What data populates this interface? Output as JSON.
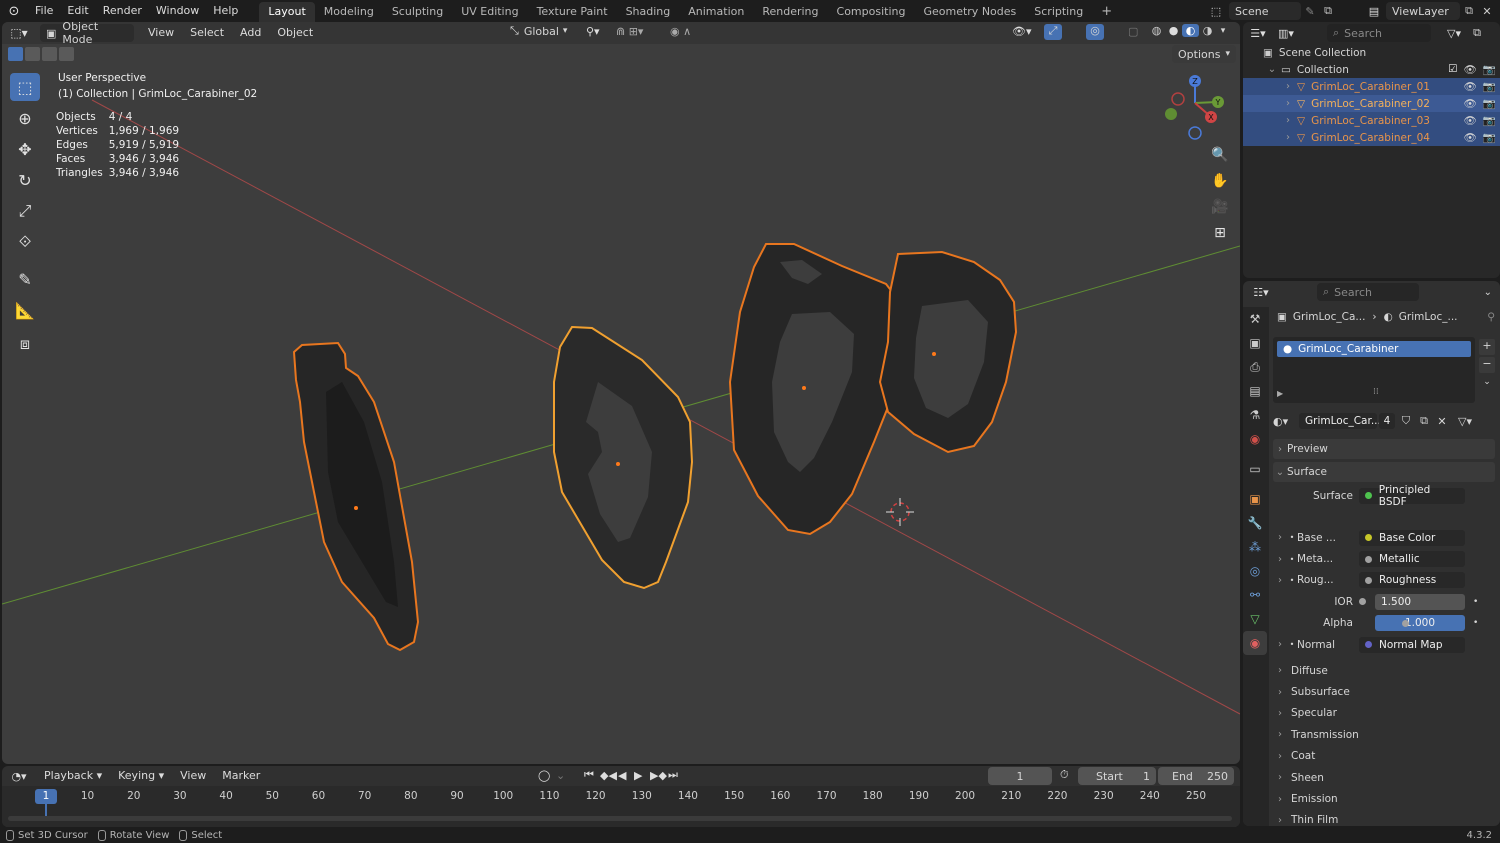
{
  "topbar": {
    "menus": [
      "File",
      "Edit",
      "Render",
      "Window",
      "Help"
    ],
    "workspaces": [
      "Layout",
      "Modeling",
      "Sculpting",
      "UV Editing",
      "Texture Paint",
      "Shading",
      "Animation",
      "Rendering",
      "Compositing",
      "Geometry Nodes",
      "Scripting"
    ],
    "active_workspace": "Layout",
    "add_tab": "+",
    "scene": "Scene",
    "view_layer": "ViewLayer"
  },
  "viewport": {
    "mode": "Object Mode",
    "menus": [
      "View",
      "Select",
      "Add",
      "Object"
    ],
    "orientation": "Global",
    "options": "Options",
    "perspective": "User Perspective",
    "collection_line": "(1) Collection | GrimLoc_Carabiner_02",
    "stats": [
      {
        "label": "Objects",
        "value": "4 / 4"
      },
      {
        "label": "Vertices",
        "value": "1,969 / 1,969"
      },
      {
        "label": "Edges",
        "value": "5,919 / 5,919"
      },
      {
        "label": "Faces",
        "value": "3,946 / 3,946"
      },
      {
        "label": "Triangles",
        "value": "3,946 / 3,946"
      }
    ],
    "gizmo_axes": {
      "x": "X",
      "y": "Y",
      "z": "Z"
    }
  },
  "outliner": {
    "search_placeholder": "Search",
    "scene_collection": "Scene Collection",
    "collection": "Collection",
    "objects": [
      {
        "name": "GrimLoc_Carabiner_01",
        "selected": true
      },
      {
        "name": "GrimLoc_Carabiner_02",
        "selected": true
      },
      {
        "name": "GrimLoc_Carabiner_03",
        "selected": true
      },
      {
        "name": "GrimLoc_Carabiner_04",
        "selected": true
      }
    ]
  },
  "properties": {
    "search_placeholder": "Search",
    "breadcrumb_obj": "GrimLoc_Ca...",
    "breadcrumb_mat": "GrimLoc_...",
    "material_slot": "GrimLoc_Carabiner",
    "material_name": "GrimLoc_Car...",
    "user_count": "4",
    "preview": "Preview",
    "surface_panel": "Surface",
    "surface_label": "Surface",
    "surface_value": "Principled BSDF",
    "inputs": [
      {
        "label": "Base ...",
        "value": "Base Color",
        "color": "#c7c729",
        "expandable": true
      },
      {
        "label": "Meta...",
        "value": "Metallic",
        "color": "#a1a1a1",
        "expandable": true
      },
      {
        "label": "Roug...",
        "value": "Roughness",
        "color": "#a1a1a1",
        "expandable": true
      },
      {
        "label": "IOR",
        "value": "1.500",
        "color": "#a1a1a1",
        "expandable": false,
        "style": "num"
      },
      {
        "label": "Alpha",
        "value": "1.000",
        "color": "#a1a1a1",
        "expandable": false,
        "style": "blue"
      },
      {
        "label": "Normal",
        "value": "Normal Map",
        "color": "#6363c7",
        "expandable": true
      }
    ],
    "subpanels": [
      "Diffuse",
      "Subsurface",
      "Specular",
      "Transmission",
      "Coat",
      "Sheen",
      "Emission",
      "Thin Film"
    ]
  },
  "timeline": {
    "menus": [
      "Playback",
      "Keying",
      "View",
      "Marker"
    ],
    "current_frame": "1",
    "start_label": "Start",
    "start": "1",
    "end_label": "End",
    "end": "250",
    "ruler": [
      "1",
      "10",
      "20",
      "30",
      "40",
      "50",
      "60",
      "70",
      "80",
      "90",
      "100",
      "110",
      "120",
      "130",
      "140",
      "150",
      "160",
      "170",
      "180",
      "190",
      "200",
      "210",
      "220",
      "230",
      "240",
      "250"
    ]
  },
  "statusbar": {
    "hints": [
      "Set 3D Cursor",
      "Rotate View",
      "Select"
    ],
    "version": "4.3.2"
  },
  "colors": {
    "accent": "#4772b3",
    "selection_outline": "#e8761f",
    "active_outline": "#f0a030",
    "x_axis": "#b04545",
    "y_axis": "#6a9a36"
  }
}
